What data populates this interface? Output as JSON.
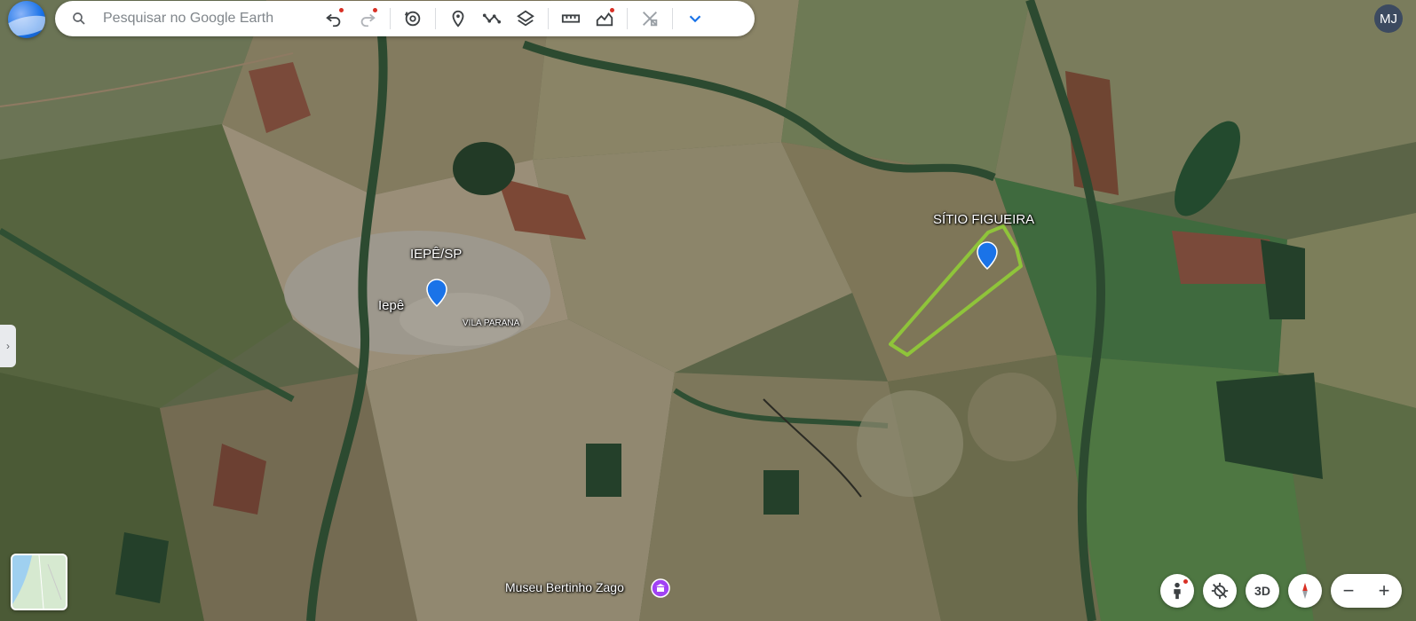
{
  "search": {
    "placeholder": "Pesquisar no Google Earth"
  },
  "user": {
    "initials": "MJ"
  },
  "places": {
    "iepe_sp": "IEPÊ/SP",
    "iepe": "Iepê",
    "vila_parana": "VILA PARANA",
    "sitio_figueira": "SÍTIO FIGUEIRA",
    "museu": "Museu Bertinho Zago"
  },
  "controls": {
    "three_d": "3D",
    "zoom_out": "−",
    "zoom_in": "+"
  },
  "colors": {
    "toolbar_accent": "#1a73e8",
    "polygon": "#8fc43a",
    "pin": "#1a73e8",
    "notification": "#d93025"
  }
}
